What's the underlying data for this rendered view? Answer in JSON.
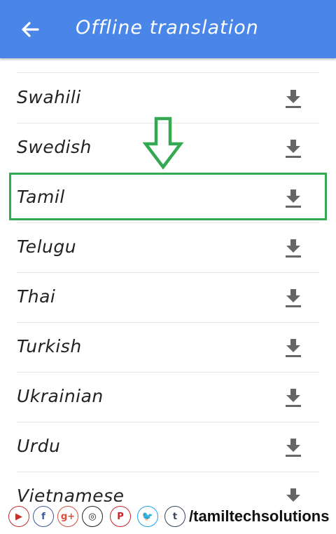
{
  "appbar": {
    "title": "Offline translation",
    "back_icon": "arrow-left-icon",
    "bg": "#4a86e8"
  },
  "languages": [
    {
      "name": "Swahili"
    },
    {
      "name": "Swedish"
    },
    {
      "name": "Tamil"
    },
    {
      "name": "Telugu"
    },
    {
      "name": "Thai"
    },
    {
      "name": "Turkish"
    },
    {
      "name": "Ukrainian"
    },
    {
      "name": "Urdu"
    },
    {
      "name": "Vietnamese"
    }
  ],
  "row_icon": "download-icon",
  "highlight_color": "#34a853",
  "footer": {
    "handle": "/tamiltechsolutions",
    "icons": [
      "youtube-icon",
      "facebook-icon",
      "google-plus-icon",
      "instagram-icon",
      "pinterest-icon",
      "twitter-icon",
      "tumblr-icon"
    ]
  }
}
